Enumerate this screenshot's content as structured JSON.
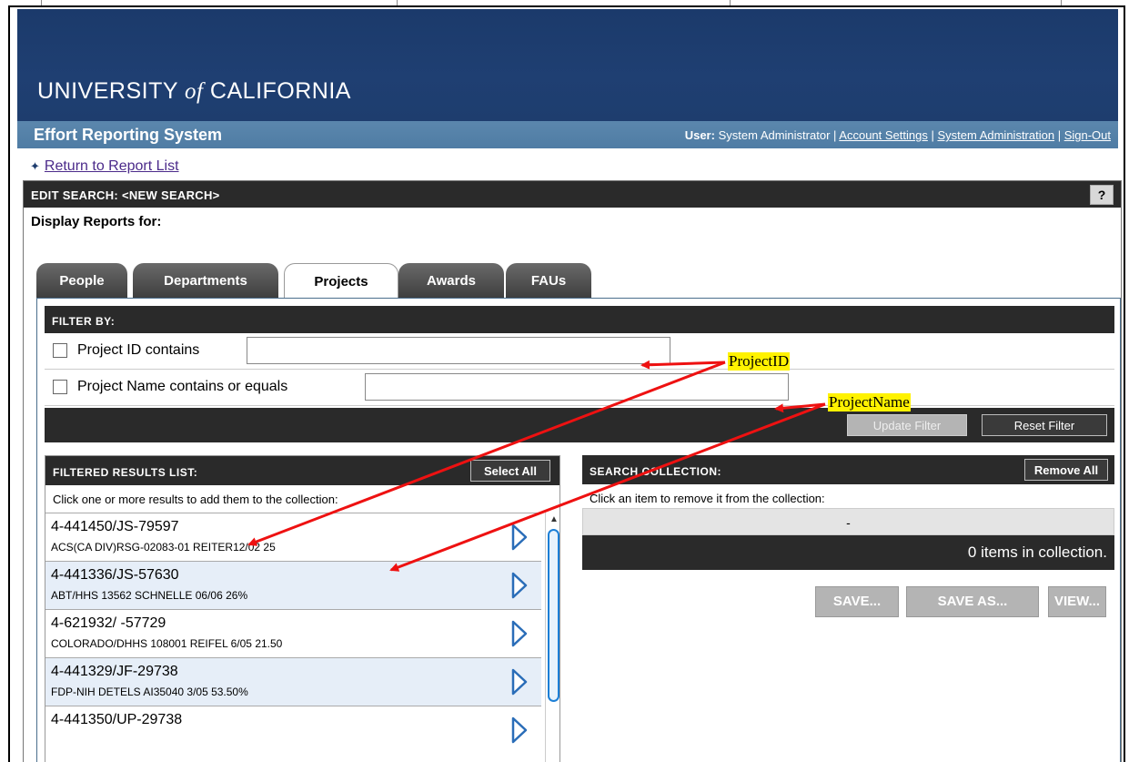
{
  "header": {
    "university_main": "UNIVERSITY ",
    "university_of": "of",
    "university_end": " CALIFORNIA",
    "system_name": "Effort Reporting System",
    "user_label": "User:",
    "user_name": "System Administrator",
    "links": [
      "Account Settings",
      "System Administration",
      "Sign-Out"
    ]
  },
  "return_link": "Return to Report List",
  "edit_search": {
    "title": "EDIT SEARCH: <NEW SEARCH>",
    "help": "?",
    "display_label": "Display Reports for:"
  },
  "tabs": [
    {
      "label": "People",
      "active": false
    },
    {
      "label": "Departments",
      "active": false
    },
    {
      "label": "Projects",
      "active": true
    },
    {
      "label": "Awards",
      "active": false
    },
    {
      "label": "FAUs",
      "active": false
    }
  ],
  "filter": {
    "title": "FILTER BY:",
    "rows": [
      {
        "label": "Project ID contains",
        "value": ""
      },
      {
        "label": "Project Name contains or equals",
        "value": ""
      }
    ],
    "update_label": "Update Filter",
    "reset_label": "Reset Filter"
  },
  "results": {
    "title": "FILTERED RESULTS LIST:",
    "select_all": "Select All",
    "hint": "Click one or more results to add them to the collection:",
    "items": [
      {
        "id": "4-441450/JS-79597",
        "name": "ACS(CA DIV)RSG-02083-01 REITER12/02 25"
      },
      {
        "id": "4-441336/JS-57630",
        "name": "ABT/HHS 13562 SCHNELLE 06/06 26%"
      },
      {
        "id": "4-621932/ -57729",
        "name": "COLORADO/DHHS 108001 REIFEL 6/05 21.50"
      },
      {
        "id": "4-441329/JF-29738",
        "name": "FDP-NIH DETELS AI35040 3/05 53.50%"
      },
      {
        "id": "4-441350/UP-29738",
        "name": ""
      }
    ]
  },
  "collection": {
    "title": "SEARCH COLLECTION:",
    "remove_all": "Remove All",
    "hint": "Click an item to remove it from the collection:",
    "empty_marker": "-",
    "count_text": "0 items in collection.",
    "buttons": [
      "SAVE...",
      "SAVE AS...",
      "VIEW..."
    ]
  },
  "annotations": {
    "project_id": "ProjectID",
    "project_name": "ProjectName",
    "arrow_color": "#ee1111"
  },
  "colors": {
    "banner": "#1e3d6e",
    "subbar": "#5582a9",
    "dark_bar": "#2a2a2a",
    "link": "#4b2a8a",
    "alt_row": "#e6eef8",
    "scroll_accent": "#1c7fd6"
  }
}
